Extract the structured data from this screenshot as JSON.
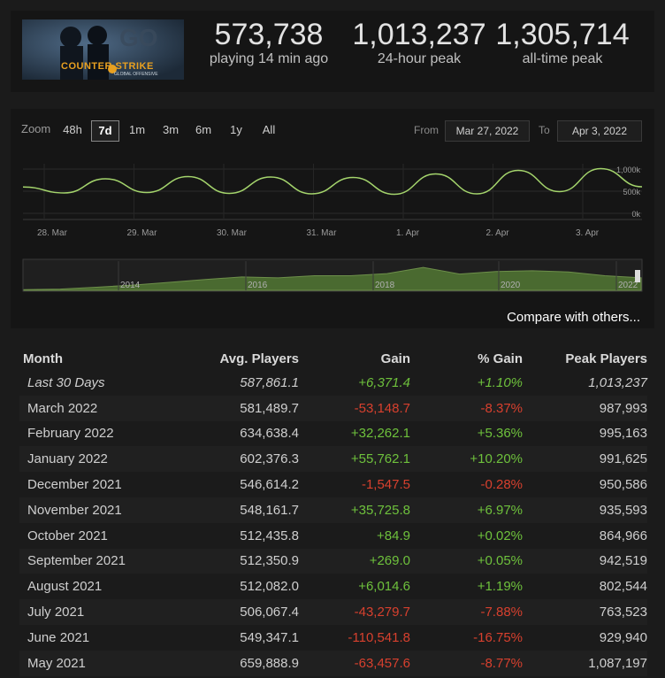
{
  "header": {
    "logo": {
      "icon": "counter-strike-logo",
      "text": "COUNTER STRIKE",
      "subtext": "GLOBAL OFFENSIVE"
    },
    "stats": [
      {
        "value": "573,738",
        "label": "playing 14 min ago"
      },
      {
        "value": "1,013,237",
        "label": "24-hour peak"
      },
      {
        "value": "1,305,714",
        "label": "all-time peak"
      }
    ]
  },
  "controls": {
    "zoom_label": "Zoom",
    "zoom_options": [
      "48h",
      "7d",
      "1m",
      "3m",
      "6m",
      "1y",
      "All"
    ],
    "active_zoom": "7d",
    "from_label": "From",
    "from_value": "Mar 27, 2022",
    "to_label": "To",
    "to_value": "Apr 3, 2022"
  },
  "chart_data": [
    {
      "type": "line",
      "x": [
        "28. Mar",
        "",
        "29. Mar",
        "",
        "30. Mar",
        "",
        "31. Mar",
        "",
        "1. Apr",
        "",
        "2. Apr",
        "",
        "3. Apr",
        ""
      ],
      "x_ticks": [
        "28. Mar",
        "29. Mar",
        "30. Mar",
        "31. Mar",
        "1. Apr",
        "2. Apr",
        "3. Apr"
      ],
      "y_ticks": [
        "1,000k",
        "500k",
        "0k"
      ],
      "ylim": [
        0,
        1000000
      ],
      "series": [
        {
          "values": [
            595000,
            460000,
            780000,
            470000,
            830000,
            450000,
            820000,
            440000,
            810000,
            430000,
            890000,
            440000,
            970000,
            490000,
            1010000,
            600000
          ]
        }
      ],
      "color": "#a4d46c",
      "grid": true
    },
    {
      "type": "area",
      "x_ticks": [
        "2014",
        "2016",
        "2018",
        "2020",
        "2022"
      ],
      "ylim": [
        0,
        1400000
      ],
      "values": [
        30000,
        60000,
        150000,
        250000,
        380000,
        520000,
        640000,
        600000,
        700000,
        700000,
        800000,
        1100000,
        780000,
        900000,
        940000,
        880000,
        700000,
        600000
      ],
      "color": "#4a6a30"
    }
  ],
  "compare_link": "Compare with others...",
  "table": {
    "headers": [
      "Month",
      "Avg. Players",
      "Gain",
      "% Gain",
      "Peak Players"
    ],
    "rows": [
      [
        "Last 30 Days",
        "587,861.1",
        "+6,371.4",
        "+1.10%",
        "1,013,237"
      ],
      [
        "March 2022",
        "581,489.7",
        "-53,148.7",
        "-8.37%",
        "987,993"
      ],
      [
        "February 2022",
        "634,638.4",
        "+32,262.1",
        "+5.36%",
        "995,163"
      ],
      [
        "January 2022",
        "602,376.3",
        "+55,762.1",
        "+10.20%",
        "991,625"
      ],
      [
        "December 2021",
        "546,614.2",
        "-1,547.5",
        "-0.28%",
        "950,586"
      ],
      [
        "November 2021",
        "548,161.7",
        "+35,725.8",
        "+6.97%",
        "935,593"
      ],
      [
        "October 2021",
        "512,435.8",
        "+84.9",
        "+0.02%",
        "864,966"
      ],
      [
        "September 2021",
        "512,350.9",
        "+269.0",
        "+0.05%",
        "942,519"
      ],
      [
        "August 2021",
        "512,082.0",
        "+6,014.6",
        "+1.19%",
        "802,544"
      ],
      [
        "July 2021",
        "506,067.4",
        "-43,279.7",
        "-7.88%",
        "763,523"
      ],
      [
        "June 2021",
        "549,347.1",
        "-110,541.8",
        "-16.75%",
        "929,940"
      ],
      [
        "May 2021",
        "659,888.9",
        "-63,457.6",
        "-8.77%",
        "1,087,197"
      ]
    ]
  }
}
